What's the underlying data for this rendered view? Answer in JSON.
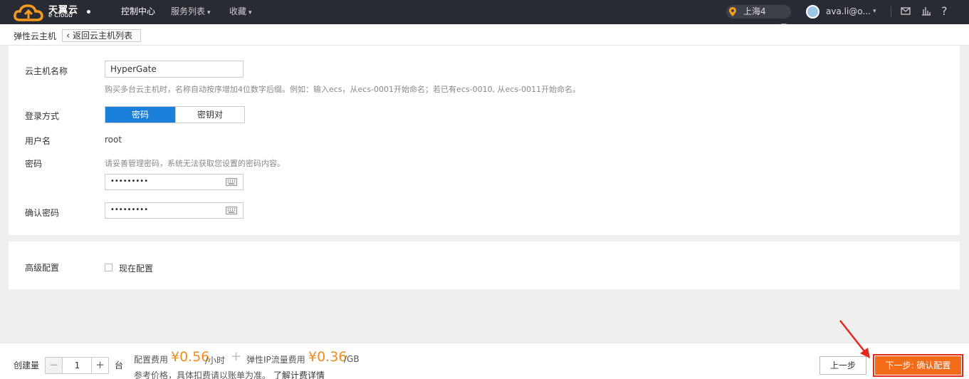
{
  "header": {
    "brand_name": "天翼云",
    "brand_sub": "e Cloud",
    "nav": [
      {
        "label": "控制中心",
        "active": true
      },
      {
        "label": "服务列表",
        "caret": "▾"
      },
      {
        "label": "收藏",
        "caret": "▾"
      }
    ],
    "region": "上海4",
    "user": "ava.li@o...",
    "user_caret": "▾",
    "icons": [
      "mail-icon",
      "chart-icon",
      "help-icon"
    ],
    "help_glyph": "?"
  },
  "breadcrumb": {
    "title": "弹性云主机",
    "back_label": "返回云主机列表",
    "back_glyph": "‹"
  },
  "form": {
    "name_label": "云主机名称",
    "name_value": "HyperGate",
    "name_hint": "购买多台云主机时，名称自动按序增加4位数字后缀。例如：输入ecs，从ecs-0001开始命名；若已有ecs-0010, 从ecs-0011开始命名。",
    "login_label": "登录方式",
    "login_options": [
      "密码",
      "密钥对"
    ],
    "login_selected": "密码",
    "username_label": "用户名",
    "username_value": "root",
    "password_label": "密码",
    "password_hint": "请妥善管理密码，系统无法获取您设置的密码内容。",
    "password_mask": "•••••••••",
    "confirm_label": "确认密码",
    "confirm_mask": "•••••••••"
  },
  "advanced": {
    "label": "高级配置",
    "checkbox_label": "现在配置",
    "checked": false
  },
  "footer": {
    "qty_label": "创建量",
    "qty_value": "1",
    "minus": "−",
    "plus": "+",
    "qty_unit": "台",
    "config_fee_label": "配置费用",
    "config_fee": "¥0.56",
    "config_fee_unit": "/小时",
    "plus_sign": "+",
    "ip_fee_label": "弹性IP流量费用",
    "ip_fee": "¥0.36",
    "ip_fee_unit": "/GB",
    "note": "参考价格，具体扣费请以账单为准。",
    "link": "了解计费详情",
    "prev_label": "上一步",
    "next_label": "下一步: 确认配置"
  },
  "colors": {
    "topbar": "#282b33",
    "accent_blue": "#1a7fd8",
    "price_orange": "#f08c1e",
    "next_button": "#f46b1a",
    "highlight_red": "#e5281e"
  }
}
